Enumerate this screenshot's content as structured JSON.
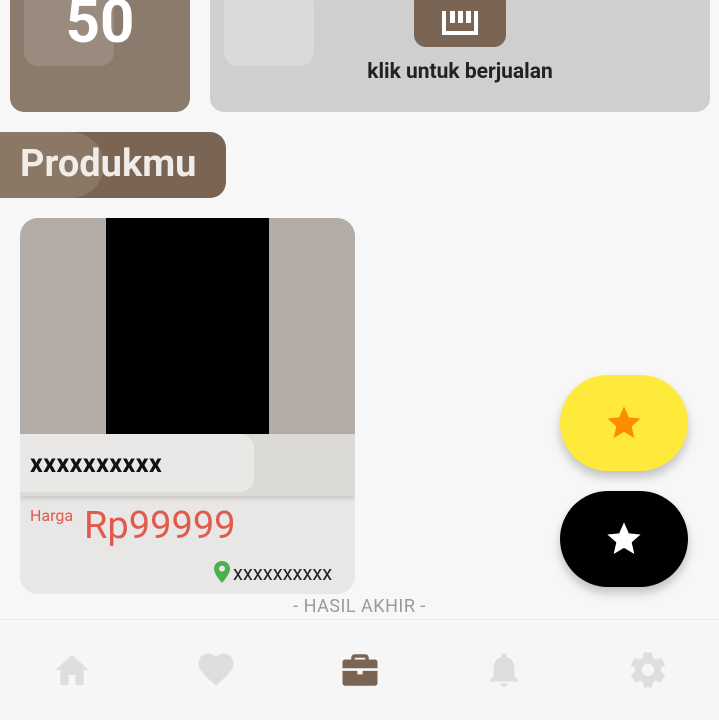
{
  "stats": {
    "count": "50"
  },
  "sell": {
    "label": "klik untuk berjualan",
    "icon": "store-icon"
  },
  "section": {
    "title": "Produkmu"
  },
  "products": [
    {
      "name": "xxxxxxxxxx",
      "price_label": "Harga",
      "price": "Rp99999",
      "location": "xxxxxxxxxx"
    }
  ],
  "result_text": "- HASIL AKHIR -",
  "fabs": [
    {
      "icon": "star-icon",
      "color": "#ffe93b",
      "icon_color": "#ff8c00"
    },
    {
      "icon": "star-icon",
      "color": "#000000",
      "icon_color": "#ffffff"
    }
  ],
  "nav": {
    "items": [
      {
        "icon": "home-icon",
        "active": false
      },
      {
        "icon": "heart-icon",
        "active": false
      },
      {
        "icon": "briefcase-icon",
        "active": true
      },
      {
        "icon": "bell-icon",
        "active": false
      },
      {
        "icon": "gear-icon",
        "active": false
      }
    ],
    "active_color": "#7a6555",
    "inactive_color": "#dedede"
  },
  "colors": {
    "brand": "#7a6555",
    "price": "#e15a4e",
    "location_pin": "#4caf50"
  }
}
